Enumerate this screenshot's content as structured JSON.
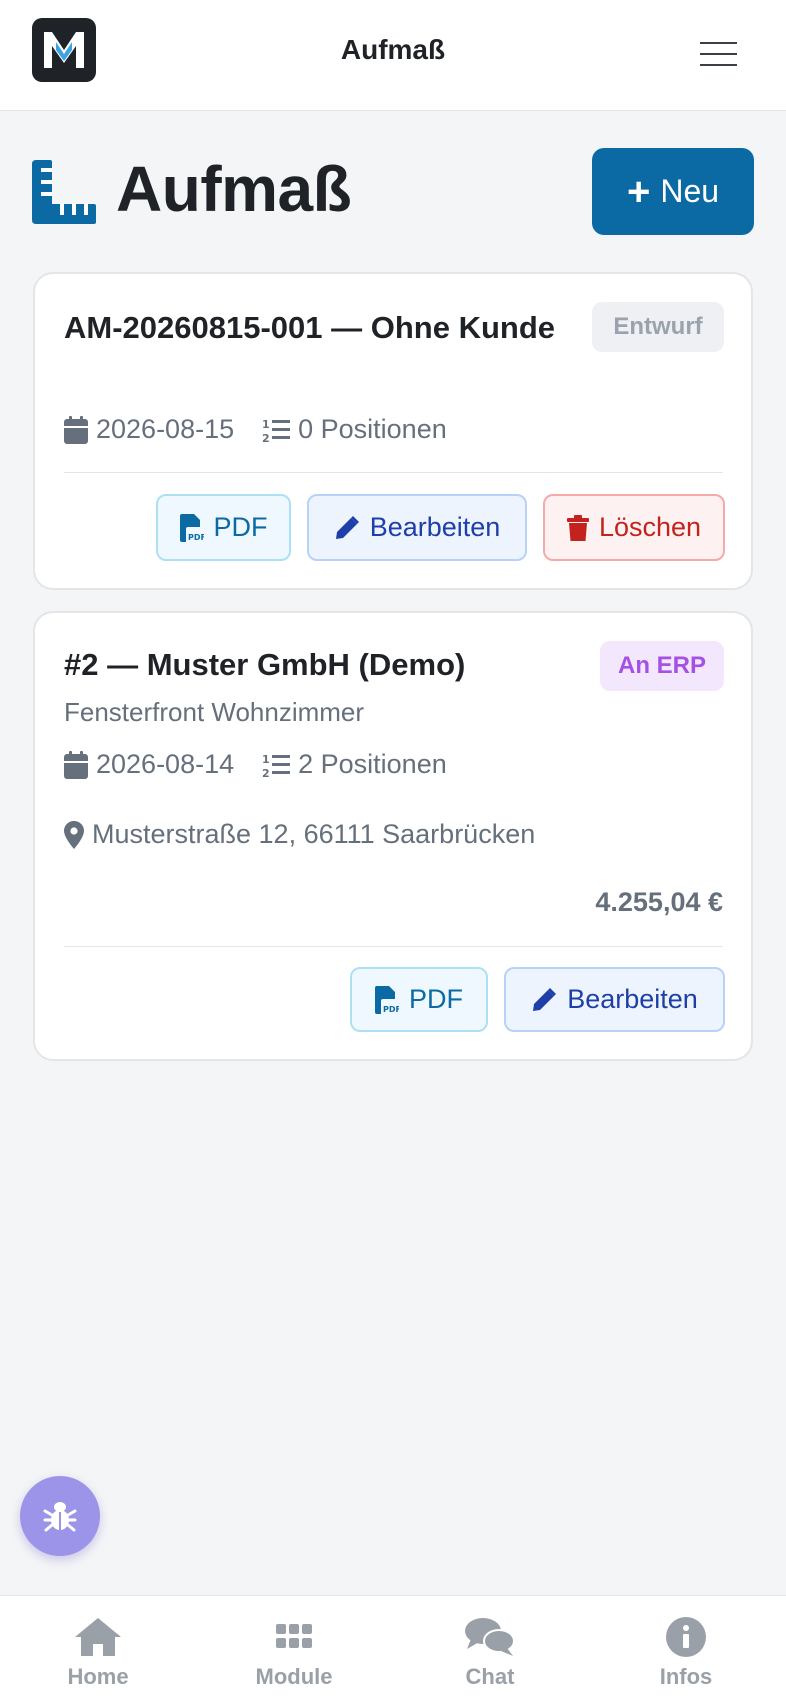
{
  "header": {
    "title": "Aufmaß",
    "menu_icon": "hamburger-icon",
    "logo_letter": "M"
  },
  "page": {
    "title": "Aufmaß",
    "icon": "ruler-icon",
    "new_button_label": "Neu",
    "accent_color": "#0b6aa3"
  },
  "records": [
    {
      "title": "AM-20260815-001 — Ohne Kunde",
      "status": "Entwurf",
      "date": "2026-08-15",
      "positions": "0 Positionen",
      "actions": {
        "pdf": "PDF",
        "edit": "Bearbeiten",
        "delete": "Löschen"
      }
    },
    {
      "title": "#2 — Muster GmbH (Demo)",
      "status": "An ERP",
      "description": "Fensterfront Wohnzimmer",
      "date": "2026-08-14",
      "positions": "2 Positionen",
      "address": "Musterstraße 12, 66111 Saarbrücken",
      "total": "4.255,04 €",
      "actions": {
        "pdf": "PDF",
        "edit": "Bearbeiten"
      }
    }
  ],
  "bug_button": {
    "icon": "bug-icon"
  },
  "bottom_nav": [
    {
      "label": "Home",
      "icon": "home-icon"
    },
    {
      "label": "Module",
      "icon": "grid-icon"
    },
    {
      "label": "Chat",
      "icon": "chat-icon"
    },
    {
      "label": "Infos",
      "icon": "info-icon"
    }
  ]
}
